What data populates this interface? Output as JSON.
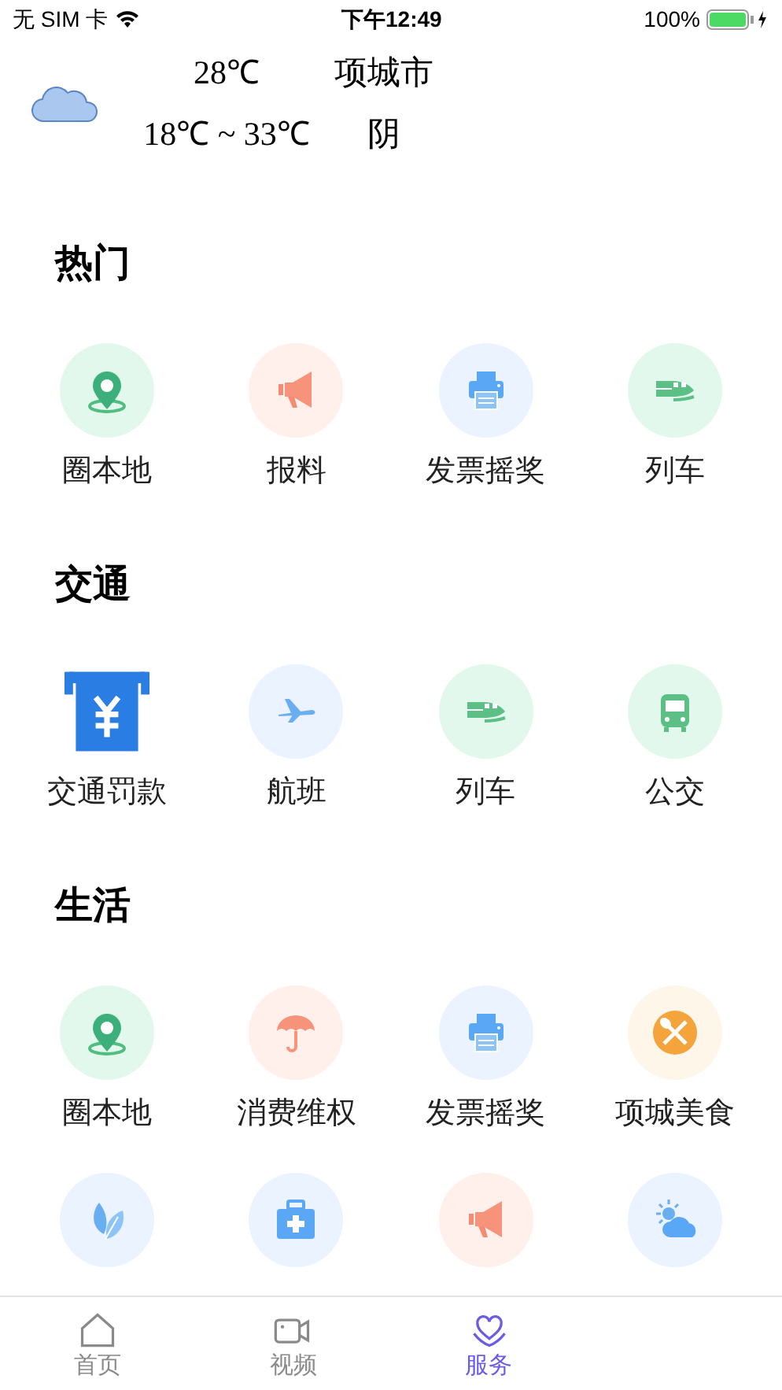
{
  "status_bar": {
    "carrier": "无 SIM 卡",
    "time": "下午12:49",
    "battery": "100%"
  },
  "weather": {
    "temperature": "28℃",
    "city": "项城市",
    "range": "18℃ ~ 33℃",
    "condition": "阴"
  },
  "sections": [
    {
      "title": "热门",
      "items": [
        {
          "kind": "pin",
          "label": "圈本地"
        },
        {
          "kind": "megaphone",
          "label": "报料"
        },
        {
          "kind": "printer",
          "label": "发票摇奖"
        },
        {
          "kind": "train",
          "label": "列车"
        }
      ]
    },
    {
      "title": "交通",
      "items": [
        {
          "kind": "fine",
          "label": "交通罚款"
        },
        {
          "kind": "plane",
          "label": "航班"
        },
        {
          "kind": "train",
          "label": "列车"
        },
        {
          "kind": "bus",
          "label": "公交"
        }
      ]
    },
    {
      "title": "生活",
      "items": [
        {
          "kind": "pin",
          "label": "圈本地"
        },
        {
          "kind": "umbrella",
          "label": "消费维权"
        },
        {
          "kind": "printer",
          "label": "发票摇奖"
        },
        {
          "kind": "food",
          "label": "项城美食"
        },
        {
          "kind": "leaf"
        },
        {
          "kind": "medkit"
        },
        {
          "kind": "megaphone"
        },
        {
          "kind": "weather"
        }
      ]
    }
  ],
  "tab_bar": [
    {
      "kind": "home",
      "label": "首页",
      "selected": false
    },
    {
      "kind": "video",
      "label": "视频",
      "selected": false
    },
    {
      "kind": "heart",
      "label": "服务",
      "selected": true
    }
  ]
}
